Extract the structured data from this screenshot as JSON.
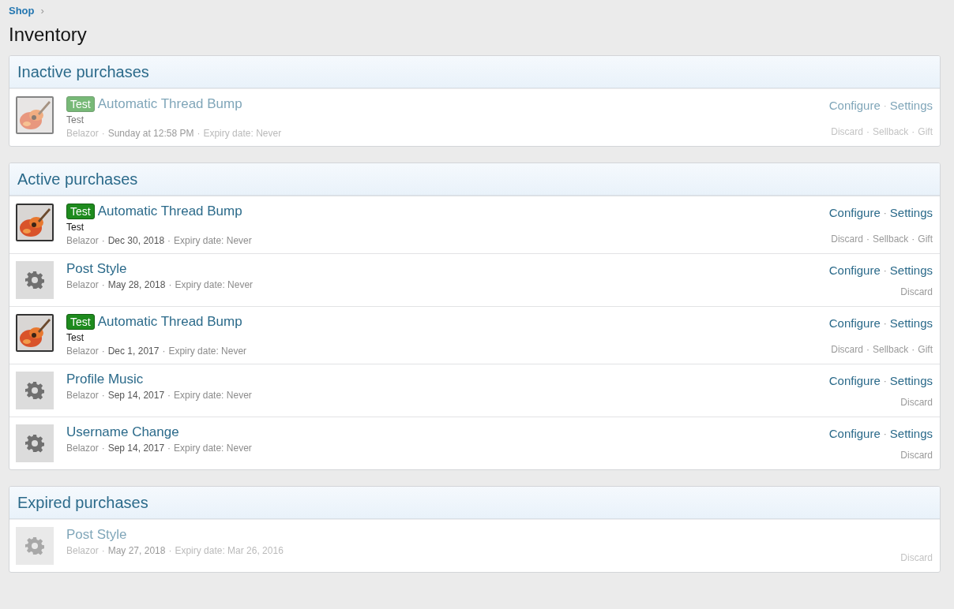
{
  "breadcrumb": {
    "label": "Shop",
    "separator": "›"
  },
  "page_title": "Inventory",
  "separator": "·",
  "sections": [
    {
      "title": "Inactive purchases",
      "items": [
        {
          "kind": "picture",
          "faded": true,
          "badge": "Test",
          "title": "Automatic Thread Bump",
          "description": "Test",
          "user": "Belazor",
          "date": "Sunday at 12:58 PM",
          "expiry": "Expiry date: Never",
          "primary_actions": [
            "Configure",
            "Settings"
          ],
          "secondary_actions": [
            "Discard",
            "Sellback",
            "Gift"
          ]
        }
      ]
    },
    {
      "title": "Active purchases",
      "items": [
        {
          "kind": "picture",
          "faded": false,
          "badge": "Test",
          "title": "Automatic Thread Bump",
          "description": "Test",
          "user": "Belazor",
          "date": "Dec 30, 2018",
          "expiry": "Expiry date: Never",
          "primary_actions": [
            "Configure",
            "Settings"
          ],
          "secondary_actions": [
            "Discard",
            "Sellback",
            "Gift"
          ]
        },
        {
          "kind": "gear",
          "faded": false,
          "title": "Post Style",
          "user": "Belazor",
          "date": "May 28, 2018",
          "expiry": "Expiry date: Never",
          "primary_actions": [
            "Configure",
            "Settings"
          ],
          "secondary_actions": [
            "Discard"
          ]
        },
        {
          "kind": "picture",
          "faded": false,
          "badge": "Test",
          "title": "Automatic Thread Bump",
          "description": "Test",
          "user": "Belazor",
          "date": "Dec 1, 2017",
          "expiry": "Expiry date: Never",
          "primary_actions": [
            "Configure",
            "Settings"
          ],
          "secondary_actions": [
            "Discard",
            "Sellback",
            "Gift"
          ]
        },
        {
          "kind": "gear",
          "faded": false,
          "title": "Profile Music",
          "user": "Belazor",
          "date": "Sep 14, 2017",
          "expiry": "Expiry date: Never",
          "primary_actions": [
            "Configure",
            "Settings"
          ],
          "secondary_actions": [
            "Discard"
          ]
        },
        {
          "kind": "gear",
          "faded": false,
          "title": "Username Change",
          "user": "Belazor",
          "date": "Sep 14, 2017",
          "expiry": "Expiry date: Never",
          "primary_actions": [
            "Configure",
            "Settings"
          ],
          "secondary_actions": [
            "Discard"
          ]
        }
      ]
    },
    {
      "title": "Expired purchases",
      "items": [
        {
          "kind": "gear",
          "faded": true,
          "title": "Post Style",
          "user": "Belazor",
          "date": "May 27, 2018",
          "expiry": "Expiry date: Mar 26, 2016",
          "secondary_actions": [
            "Discard"
          ]
        }
      ]
    }
  ]
}
